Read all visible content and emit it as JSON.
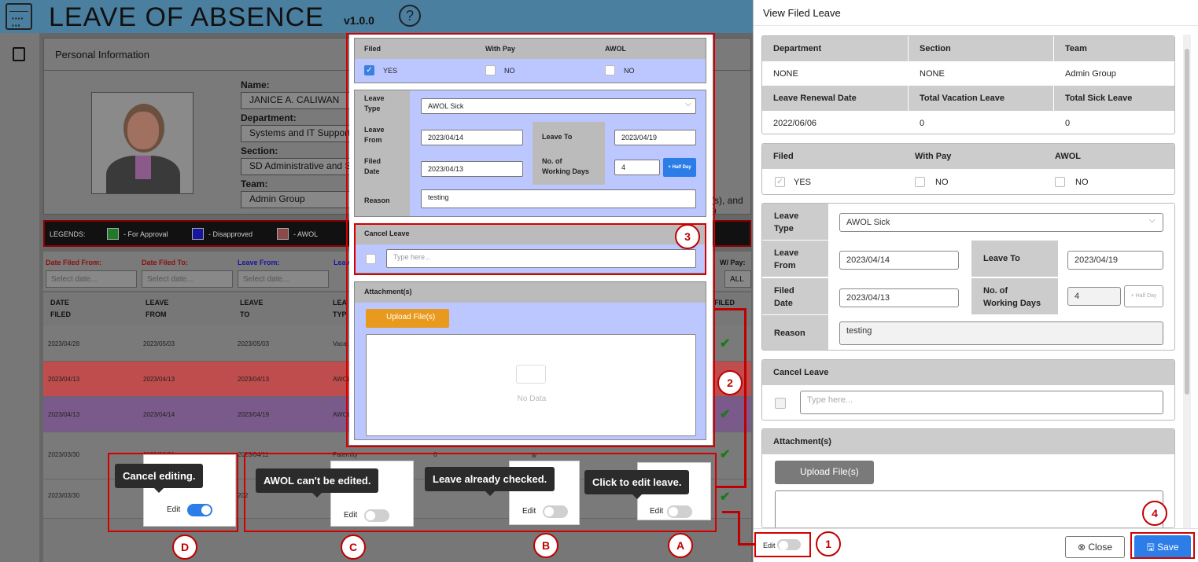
{
  "app": {
    "title": "LEAVE OF ABSENCE",
    "version": "v1.0.0",
    "help": "?"
  },
  "personal": {
    "title": "Personal Information",
    "name_label": "Name:",
    "name": "JANICE A. CALIWAN",
    "dept_label": "Department:",
    "dept": "Systems and IT Support",
    "section_label": "Section:",
    "section": "SD Administrative and S",
    "team_label": "Team:",
    "team": "Admin Group",
    "tail1": "(s), and 9"
  },
  "legends": {
    "label": "LEGENDS:",
    "approval": "- For Approval",
    "disapproved": "- Disapproved",
    "awol": "- AWOL",
    "colors": {
      "approval": "#1f7a2a",
      "disapproved": "#1616a0",
      "awol": "#8a4a4a"
    }
  },
  "filters": {
    "date_from": "Date Filed From:",
    "date_to": "Date Filed To:",
    "leave_from": "Leave From:",
    "leave_to": "Leav",
    "wpay": "W/ Pay:",
    "placeholder": "Select date...",
    "all": "ALL"
  },
  "table": {
    "headers": [
      "DATE\nFILED",
      "LEAVE\nFROM",
      "LEAVE\nTO",
      "LEA\nTYP",
      "FILED"
    ],
    "rows": [
      {
        "filed": "2023/04/28",
        "from": "2023/05/03",
        "to": "2023/05/03",
        "type": "Vacat",
        "bg": "#7a7a7a"
      },
      {
        "filed": "2023/04/13",
        "from": "2023/04/13",
        "to": "2023/04/13",
        "type": "AWOL",
        "bg": "#c04d4d"
      },
      {
        "filed": "2023/04/13",
        "from": "2023/04/14",
        "to": "2023/04/19",
        "type": "AWOL",
        "bg": "#7a5a8a"
      },
      {
        "filed": "2023/03/30",
        "from": "2023/03/31",
        "to": "2023/04/11",
        "type": "Paternity",
        "days": "6",
        "bg": "#7a7a7a"
      },
      {
        "filed": "2023/03/30",
        "from": "",
        "to": "202",
        "type": "",
        "bg": "#7a7a7a"
      }
    ]
  },
  "modal": {
    "filed": "Filed",
    "with_pay": "With Pay",
    "awol": "AWOL",
    "yes": "YES",
    "no": "NO",
    "leave_type_label": "Leave\nType",
    "leave_type": "AWOL Sick",
    "leave_from_label": "Leave\nFrom",
    "leave_from": "2023/04/14",
    "leave_to_label": "Leave To",
    "leave_to": "2023/04/19",
    "filed_date_label": "Filed\nDate",
    "filed_date": "2023/04/13",
    "working_days_label": "No. of\nWorking Days",
    "working_days": "4",
    "half_day": "+ Half Day",
    "reason_label": "Reason",
    "reason": "testing",
    "cancel_label": "Cancel Leave",
    "cancel_placeholder": "Type here...",
    "attach_label": "Attachment(s)",
    "upload": "Upload File(s)",
    "no_data": "No Data"
  },
  "tooltips": {
    "d": "Cancel editing.",
    "c": "AWOL can't be edited.",
    "b": "Leave already checked.",
    "a": "Click to edit leave.",
    "edit": "Edit",
    "row_w": "w"
  },
  "markers": {
    "m1": "1",
    "m2": "2",
    "m3": "3",
    "m4": "4",
    "ma": "A",
    "mb": "B",
    "mc": "C",
    "md": "D"
  },
  "panel": {
    "title": "View Filed Leave",
    "grid_headers1": [
      "Department",
      "Section",
      "Team"
    ],
    "grid_values1": [
      "NONE",
      "NONE",
      "Admin Group"
    ],
    "grid_headers2": [
      "Leave Renewal Date",
      "Total Vacation Leave",
      "Total Sick Leave"
    ],
    "grid_values2": [
      "2022/06/06",
      "0",
      "0"
    ],
    "filed": "Filed",
    "with_pay": "With Pay",
    "awol": "AWOL",
    "yes": "YES",
    "no": "NO",
    "leave_type_label": "Leave\nType",
    "leave_type": "AWOL Sick",
    "leave_from_label": "Leave\nFrom",
    "leave_from": "2023/04/14",
    "leave_to_label": "Leave To",
    "leave_to": "2023/04/19",
    "filed_date_label": "Filed\nDate",
    "filed_date": "2023/04/13",
    "working_days_label": "No. of\nWorking Days",
    "working_days": "4",
    "half_day": "+ Half Day",
    "reason_label": "Reason",
    "reason": "testing",
    "cancel_label": "Cancel Leave",
    "cancel_placeholder": "Type here...",
    "attach_label": "Attachment(s)",
    "upload": "Upload File(s)",
    "edit": "Edit",
    "close": "Close",
    "save": "Save"
  }
}
